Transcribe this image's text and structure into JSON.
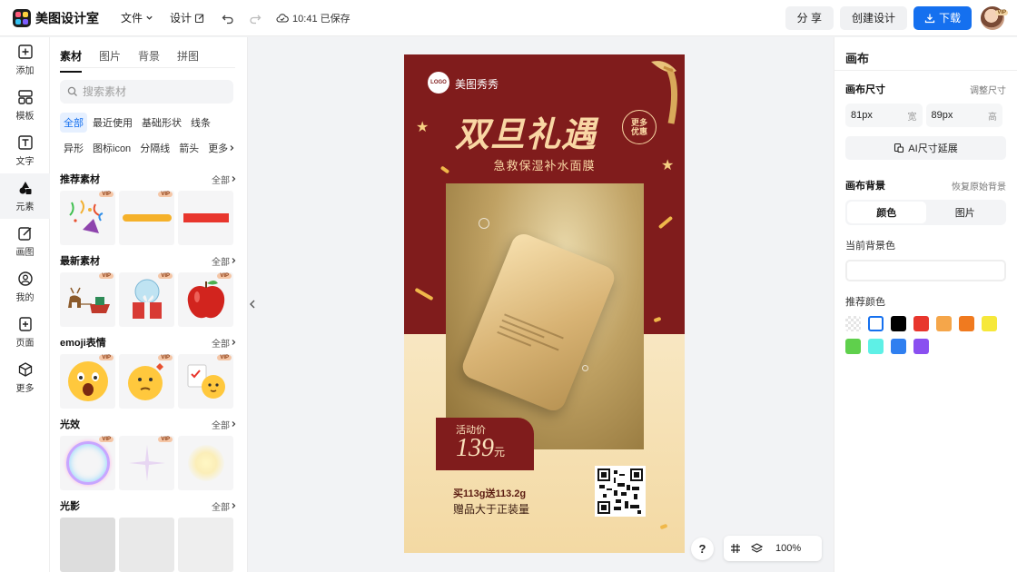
{
  "app": {
    "name": "美图设计室"
  },
  "topbar": {
    "file_menu": "文件",
    "design_menu": "设计",
    "saved_status": "10:41 已保存",
    "share_label": "分 享",
    "create_label": "创建设计",
    "download_label": "下载",
    "avatar_badge": "VIP"
  },
  "rail": [
    {
      "label": "添加",
      "icon": "plus-square-icon"
    },
    {
      "label": "模板",
      "icon": "template-icon"
    },
    {
      "label": "文字",
      "icon": "text-icon"
    },
    {
      "label": "元素",
      "icon": "shapes-icon",
      "active": true
    },
    {
      "label": "画图",
      "icon": "draw-icon"
    },
    {
      "label": "我的",
      "icon": "user-icon"
    },
    {
      "label": "页面",
      "icon": "add-page-icon"
    },
    {
      "label": "更多",
      "icon": "cube-icon"
    }
  ],
  "panel": {
    "tabs": [
      "素材",
      "图片",
      "背景",
      "拼图"
    ],
    "search_placeholder": "搜索素材",
    "chips": [
      "全部",
      "最近使用",
      "基础形状",
      "线条",
      "异形",
      "图标icon",
      "分隔线",
      "箭头",
      "更多"
    ],
    "all_label": "全部",
    "vip_label": "VIP",
    "sections": [
      {
        "title": "推荐素材"
      },
      {
        "title": "最新素材"
      },
      {
        "title": "emoji表情"
      },
      {
        "title": "光效"
      },
      {
        "title": "光影"
      }
    ]
  },
  "poster": {
    "brand_logo": "LOGO",
    "brand_name": "美图秀秀",
    "headline": "双旦礼遇",
    "badge": "更多优惠",
    "subline": "急救保湿补水面膜",
    "price_label": "活动价",
    "price_value": "139",
    "price_unit": "元",
    "promo_line1": "买113g送113.2g",
    "promo_line2": "赠品大于正装量"
  },
  "canvas_controls": {
    "help": "?",
    "zoom": "100%"
  },
  "right_panel": {
    "title": "画布",
    "size_label": "画布尺寸",
    "size_link": "调整尺寸",
    "width_value": "81px",
    "width_unit": "宽",
    "height_value": "89px",
    "height_unit": "高",
    "ai_button": "AI尺寸延展",
    "bg_label": "画布背景",
    "bg_link": "恢复原始背景",
    "seg_color": "颜色",
    "seg_image": "图片",
    "current_bg_label": "当前背景色",
    "recommended_label": "推荐颜色",
    "swatches": [
      "transparent",
      "#ffffff",
      "#000000",
      "#e8362d",
      "#f5a64a",
      "#f07a1f",
      "#f6e83a",
      "#5fd04c",
      "#5ef0e6",
      "#2f7ff0",
      "#8a4ff0"
    ]
  }
}
